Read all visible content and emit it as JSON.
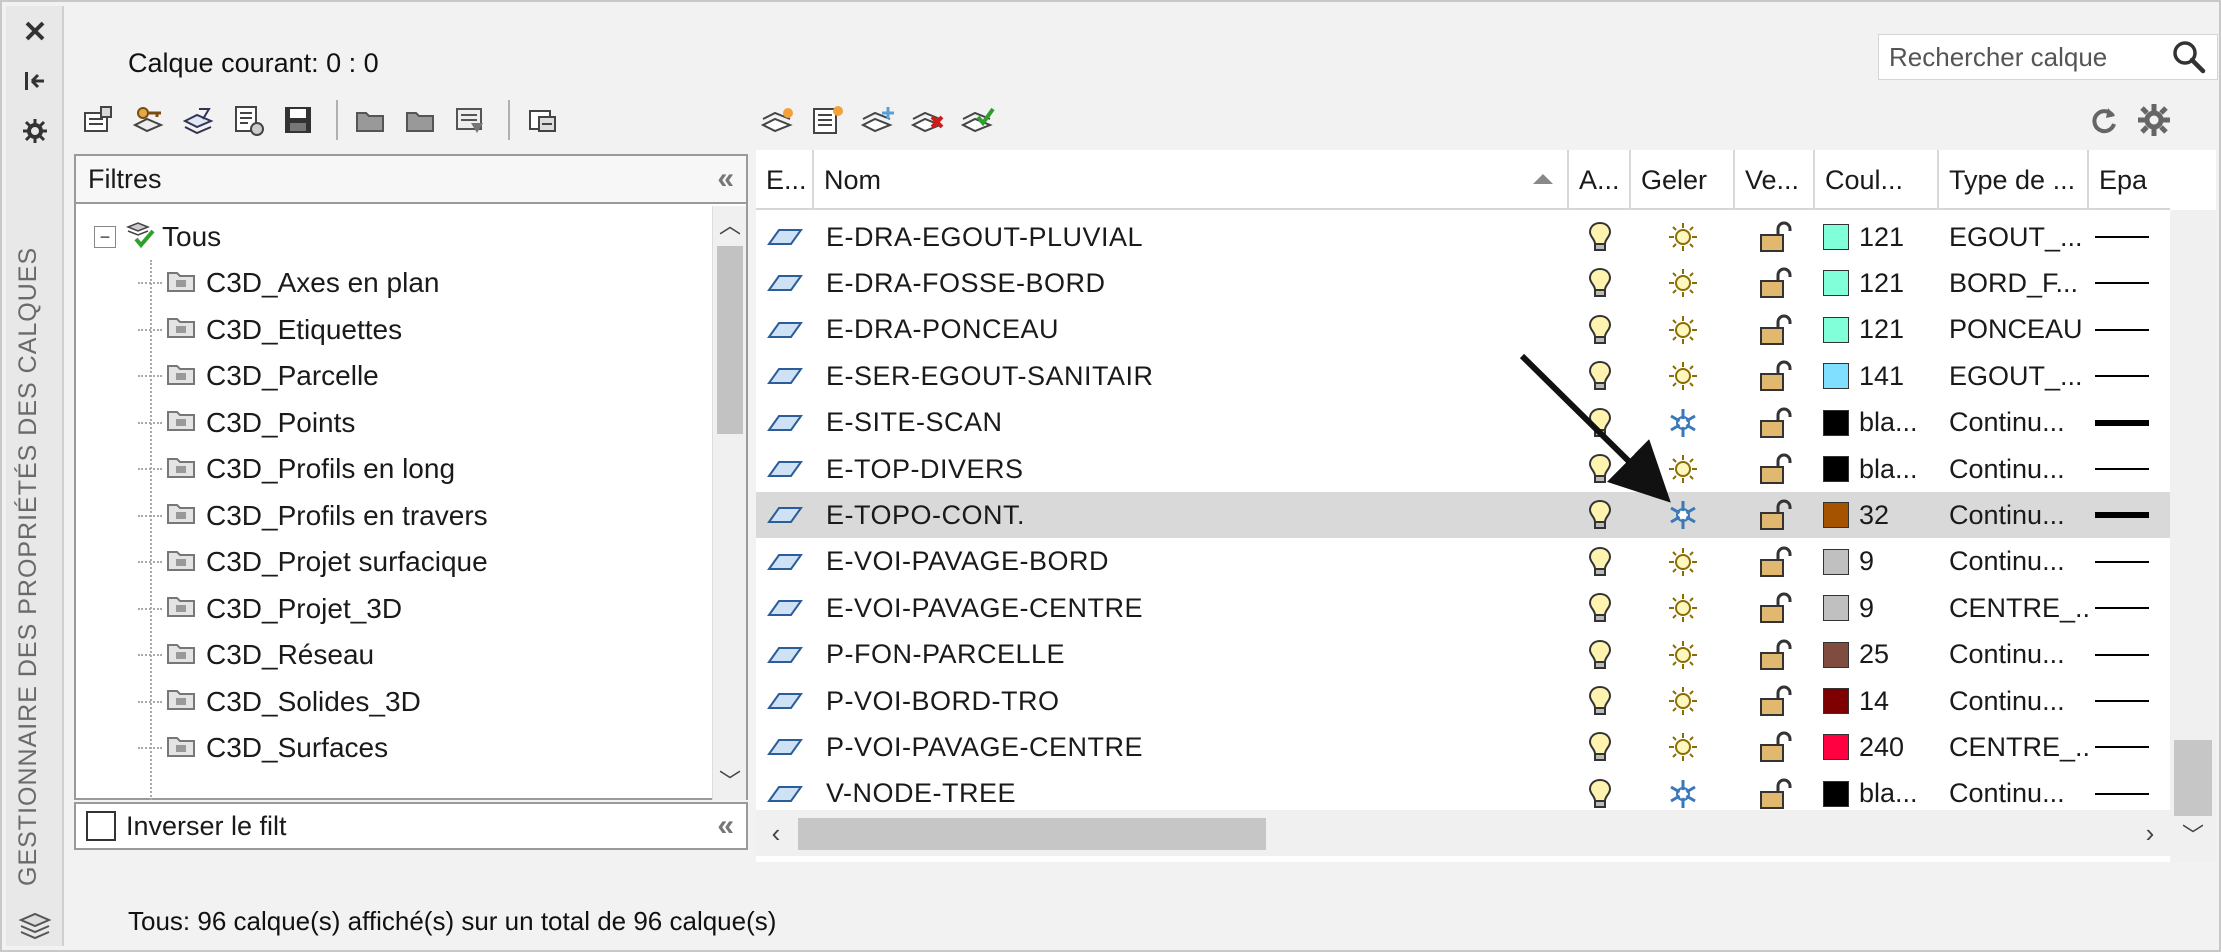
{
  "palette": {
    "title": "GESTIONNAIRE DES PROPRIÉTÉS DES CALQUES",
    "close_icon": "close-icon",
    "pin_icon": "autohide-icon",
    "properties_icon": "properties-icon"
  },
  "current_layer": "Calque courant: 0 : 0",
  "search": {
    "placeholder": "Rechercher calque"
  },
  "filters": {
    "title": "Filtres",
    "root": "Tous",
    "items": [
      "C3D_Axes en plan",
      "C3D_Etiquettes",
      "C3D_Parcelle",
      "C3D_Points",
      "C3D_Profils en long",
      "C3D_Profils en travers",
      "C3D_Projet surfacique",
      "C3D_Projet_3D",
      "C3D_Réseau",
      "C3D_Solides_3D",
      "C3D_Surfaces"
    ],
    "invert_label": "Inverser  le filt"
  },
  "columns": {
    "status": "E...",
    "name": "Nom",
    "on": "A...",
    "freeze": "Geler",
    "lock": "Ve...",
    "color": "Coul...",
    "linetype": "Type de ...",
    "lineweight": "Epa"
  },
  "layers": [
    {
      "name": "E-DRA-EGOUT-PLUVIAL",
      "frozen": false,
      "color": "#80ffd9",
      "color_label": "121",
      "linetype": "EGOUT_...",
      "lineweight": "thin"
    },
    {
      "name": "E-DRA-FOSSE-BORD",
      "frozen": false,
      "color": "#80ffd9",
      "color_label": "121",
      "linetype": "BORD_F...",
      "lineweight": "thin"
    },
    {
      "name": "E-DRA-PONCEAU",
      "frozen": false,
      "color": "#80ffd9",
      "color_label": "121",
      "linetype": "PONCEAU",
      "lineweight": "thin"
    },
    {
      "name": "E-SER-EGOUT-SANITAIR",
      "frozen": false,
      "color": "#80dfff",
      "color_label": "141",
      "linetype": "EGOUT_...",
      "lineweight": "thin"
    },
    {
      "name": "E-SITE-SCAN",
      "frozen": true,
      "color": "#000000",
      "color_label": "bla...",
      "linetype": "Continu...",
      "lineweight": "thick"
    },
    {
      "name": "E-TOP-DIVERS",
      "frozen": false,
      "color": "#000000",
      "color_label": "bla...",
      "linetype": "Continu...",
      "lineweight": "thin"
    },
    {
      "name": "E-TOPO-CONT.",
      "frozen": true,
      "color": "#a65300",
      "color_label": "32",
      "linetype": "Continu...",
      "lineweight": "thick",
      "selected": true
    },
    {
      "name": "E-VOI-PAVAGE-BORD",
      "frozen": false,
      "color": "#c0c0c0",
      "color_label": "9",
      "linetype": "Continu...",
      "lineweight": "thin"
    },
    {
      "name": "E-VOI-PAVAGE-CENTRE",
      "frozen": false,
      "color": "#c0c0c0",
      "color_label": "9",
      "linetype": "CENTRE_...",
      "lineweight": "thin"
    },
    {
      "name": "P-FON-PARCELLE",
      "frozen": false,
      "color": "#7f4c3f",
      "color_label": "25",
      "linetype": "Continu...",
      "lineweight": "thin"
    },
    {
      "name": "P-VOI-BORD-TRO",
      "frozen": false,
      "color": "#7f0000",
      "color_label": "14",
      "linetype": "Continu...",
      "lineweight": "thin"
    },
    {
      "name": "P-VOI-PAVAGE-CENTRE",
      "frozen": false,
      "color": "#ff0040",
      "color_label": "240",
      "linetype": "CENTRE_...",
      "lineweight": "thin"
    },
    {
      "name": "V-NODE-TREE",
      "frozen": true,
      "color": "#000000",
      "color_label": "bla...",
      "linetype": "Continu...",
      "lineweight": "thin"
    }
  ],
  "status": "Tous: 96 calque(s) affiché(s) sur un total de 96 calque(s)"
}
